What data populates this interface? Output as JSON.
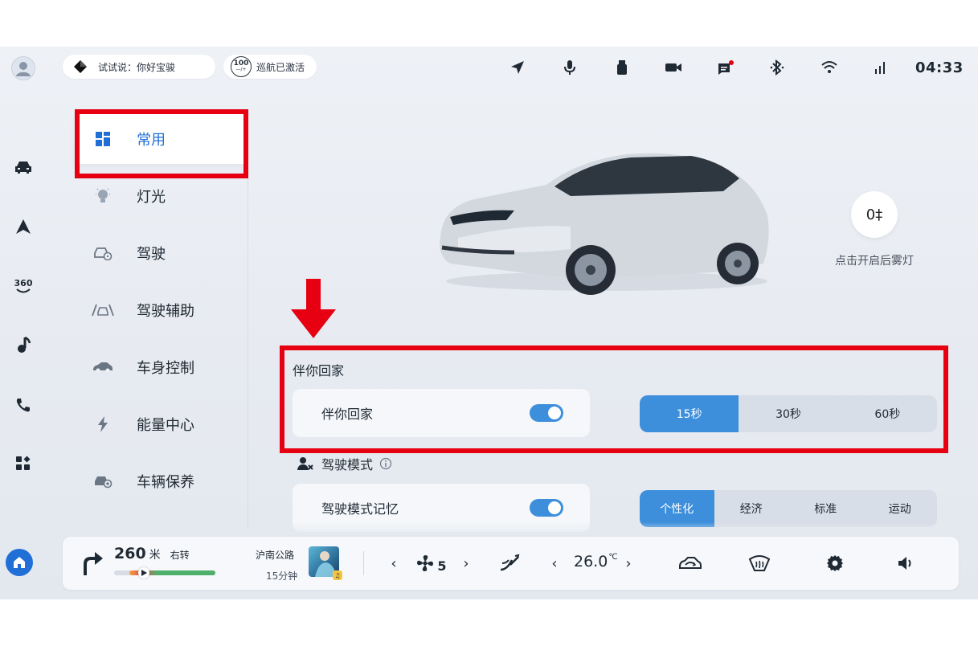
{
  "status_bar": {
    "voice_hint": "试试说：你好宝骏",
    "speed_badge": "100",
    "speed_badge_sub": "—/+",
    "cruise_status": "巡航已激活",
    "time": "04:33"
  },
  "rail": {
    "badge_360": "360"
  },
  "menu": {
    "items": [
      {
        "label": "常用"
      },
      {
        "label": "灯光"
      },
      {
        "label": "驾驶"
      },
      {
        "label": "驾驶辅助"
      },
      {
        "label": "车身控制"
      },
      {
        "label": "能量中心"
      },
      {
        "label": "车辆保养"
      }
    ]
  },
  "car_panel": {
    "fog_icon_glyph": "0‡",
    "fog_label": "点击开启后雾灯"
  },
  "accompany_home": {
    "section_title": "伴你回家",
    "toggle_label": "伴你回家",
    "toggle_on": true,
    "options": [
      "15秒",
      "30秒",
      "60秒"
    ],
    "selected": 0
  },
  "drive_mode": {
    "section_title": "驾驶模式",
    "toggle_label": "驾驶模式记忆",
    "toggle_on": true,
    "options": [
      "个性化",
      "经济",
      "标准",
      "运动"
    ],
    "selected": 0
  },
  "dock": {
    "nav_distance": "260",
    "nav_unit": "米",
    "nav_turn": "右转",
    "road_name": "沪南公路",
    "eta": "15分钟",
    "music_badge": "♫",
    "fan_prev": "‹",
    "fan_level": "5",
    "fan_next": "›",
    "temp_prev": "‹",
    "temperature": "26.0",
    "temp_unit": "℃",
    "temp_next": "›",
    "progress": 0.85
  },
  "colors": {
    "accent": "#3d8fdc",
    "annotation_red": "#e60012"
  }
}
